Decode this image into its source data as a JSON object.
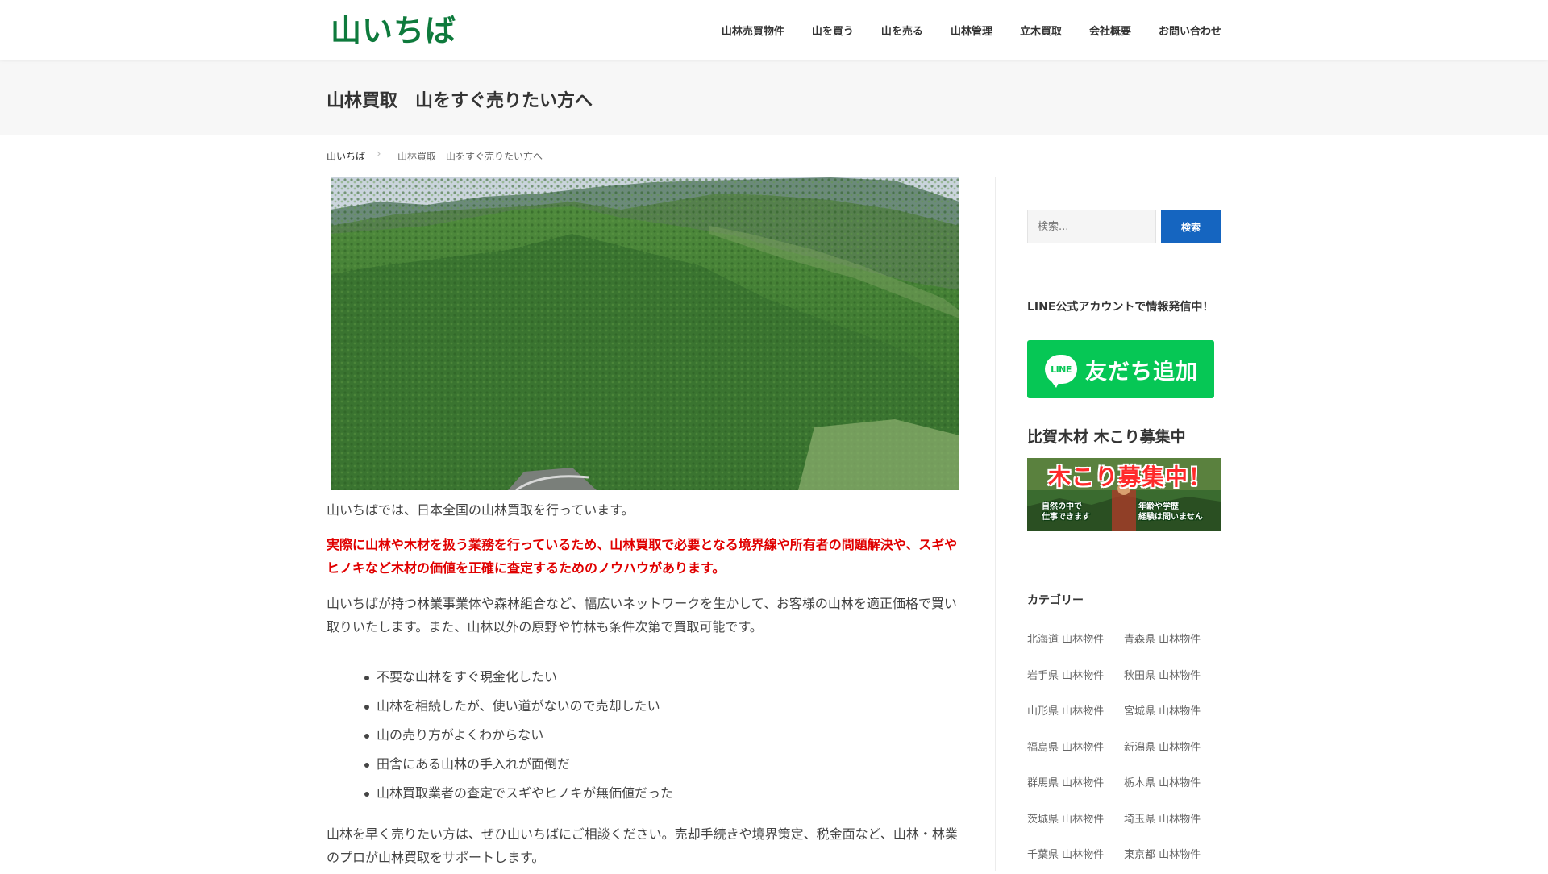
{
  "header": {
    "logo": "山いちば",
    "nav": [
      "山林売買物件",
      "山を買う",
      "山を売る",
      "山林管理",
      "立木買取",
      "会社概要",
      "お問い合わせ"
    ]
  },
  "page": {
    "title": "山林買取　山をすぐ売りたい方へ"
  },
  "breadcrumb": {
    "home": "山いちば",
    "current": "山林買取　山をすぐ売りたい方へ"
  },
  "hero": {
    "image": "forest-mountain-photo"
  },
  "content": {
    "intro": "山いちばでは、日本全国の山林買取を行っています。",
    "highlight": "実際に山林や木材を扱う業務を行っているため、山林買取で必要となる境界線や所有者の問題解決や、スギやヒノキなど木材の価値を正確に査定するためのノウハウがあります。",
    "network": "山いちばが持つ林業事業体や森林組合など、幅広いネットワークを生かして、お客様の山林を適正価格で買い取りいたします。また、山林以外の原野や竹林も条件次第で買取可能です。",
    "bullets": [
      "不要な山林をすぐ現金化したい",
      "山林を相続したが、使い道がないので売却したい",
      "山の売り方がよくわからない",
      "田舎にある山林の手入れが面倒だ",
      "山林買取業者の査定でスギやヒノキが無価値だった"
    ],
    "closing": "山林を早く売りたい方は、ぜひ山いちばにご相談ください。売却手続きや境界策定、税金面など、山林・林業のプロが山林買取をサポートします。"
  },
  "sidebar": {
    "search_placeholder": "検索...",
    "search_button": "検索",
    "line_heading": "LINE公式アカウントで情報発信中！",
    "line_logo_text": "LINE",
    "line_button": "友だち追加",
    "recruit_heading": "比賀木材 木こり募集中",
    "recruit_title": "木こり募集中！",
    "recruit_left": "自然の中で\n仕事できます",
    "recruit_right": "年齢や学歴\n経験は問いません",
    "category_heading": "カテゴリー",
    "categories": [
      "北海道 山林物件",
      "青森県 山林物件",
      "岩手県 山林物件",
      "秋田県 山林物件",
      "山形県 山林物件",
      "宮城県 山林物件",
      "福島県 山林物件",
      "新潟県 山林物件",
      "群馬県 山林物件",
      "栃木県 山林物件",
      "茨城県 山林物件",
      "埼玉県 山林物件",
      "千葉県 山林物件",
      "東京都 山林物件"
    ]
  },
  "colors": {
    "logo_green": "#0e7a3c",
    "highlight_red": "#e00000",
    "search_blue": "#1565c0",
    "line_green": "#06c755"
  }
}
